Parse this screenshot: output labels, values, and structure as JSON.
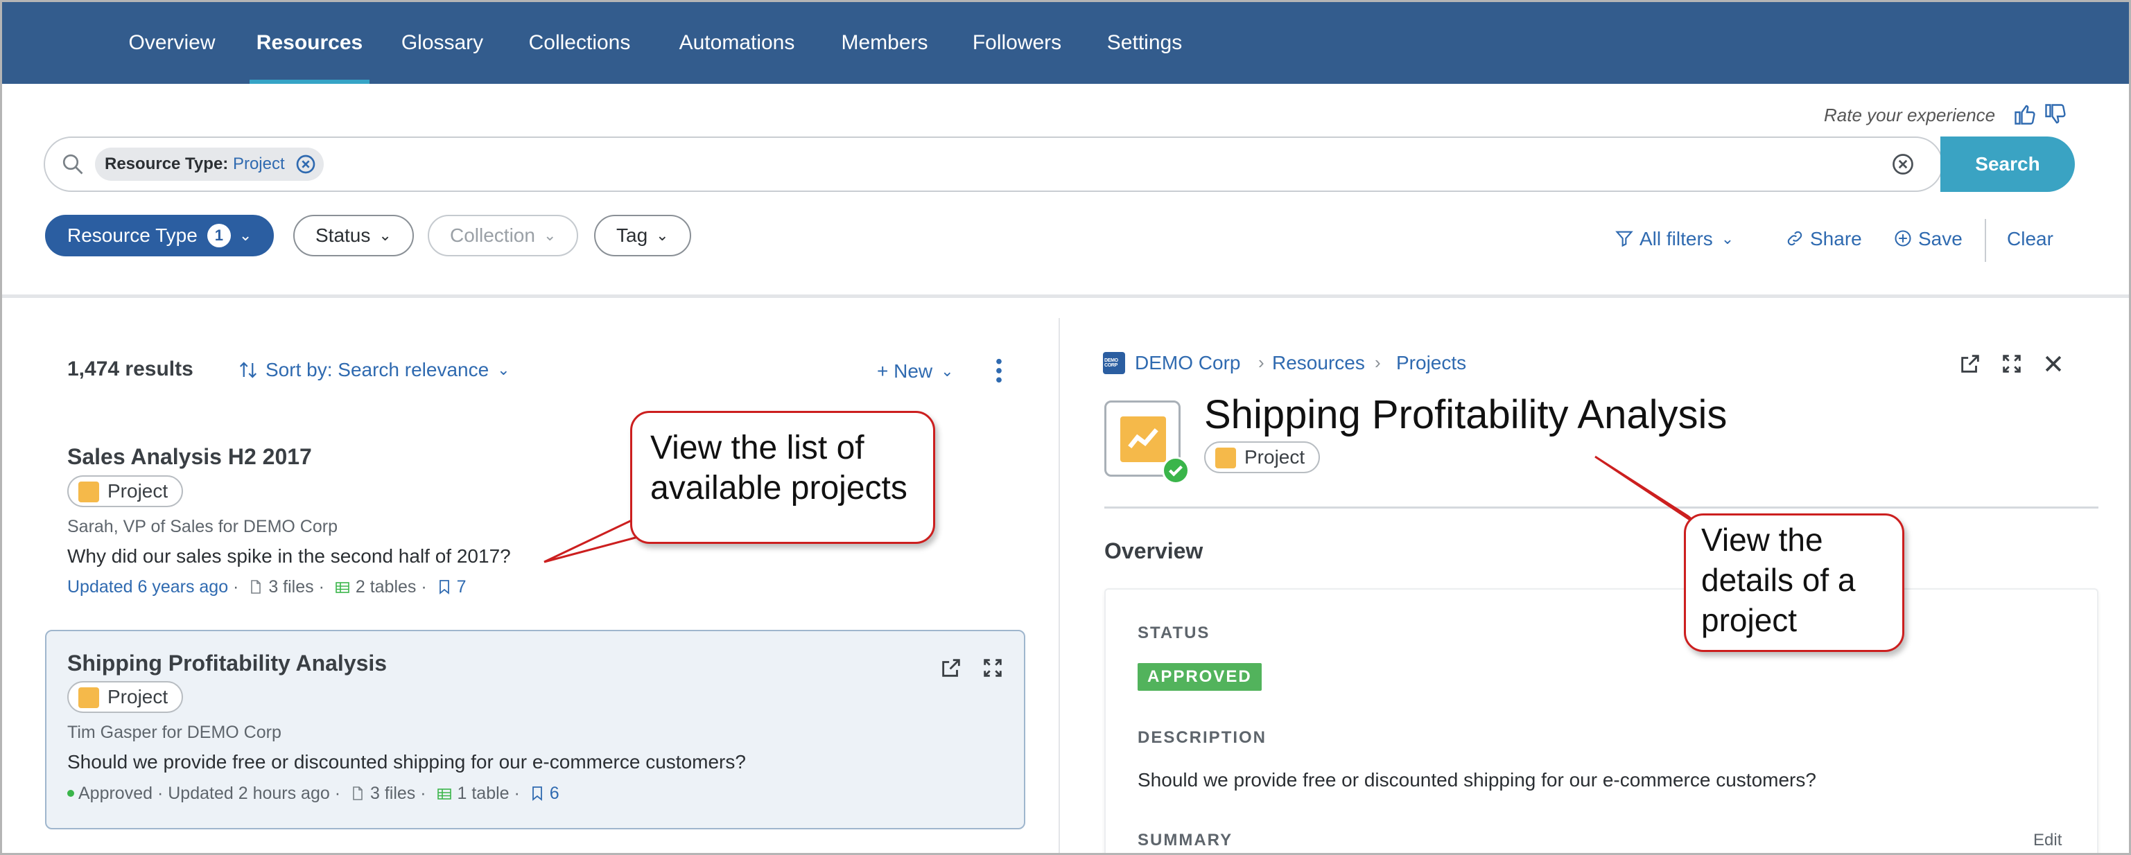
{
  "nav": {
    "tabs": [
      "Overview",
      "Resources",
      "Glossary",
      "Collections",
      "Automations",
      "Members",
      "Followers",
      "Settings"
    ],
    "active": "Resources"
  },
  "rate": {
    "label": "Rate your experience"
  },
  "search": {
    "chip_key": "Resource Type:",
    "chip_value": "Project",
    "button": "Search"
  },
  "filters": {
    "resource_type": "Resource Type",
    "resource_type_count": "1",
    "status": "Status",
    "collection": "Collection",
    "tag": "Tag",
    "all_filters": "All filters",
    "share": "Share",
    "save": "Save",
    "clear": "Clear"
  },
  "list": {
    "count": "1,474 results",
    "sort": "Sort by: Search relevance",
    "new": "+ New",
    "items": [
      {
        "title": "Sales Analysis H2 2017",
        "type": "Project",
        "author": "Sarah, VP of Sales for DEMO Corp",
        "question": "Why did our sales spike in the second half of 2017?",
        "updated": "Updated 6 years ago",
        "files": "3 files",
        "tables": "2 tables",
        "bookmarks": "7"
      },
      {
        "title": "Shipping Profitability Analysis",
        "type": "Project",
        "author": "Tim Gasper for DEMO Corp",
        "question": "Should we provide free or discounted shipping for our e-commerce customers?",
        "status": "Approved",
        "updated": "Updated 2 hours ago",
        "files": "3 files",
        "tables": "1 table",
        "bookmarks": "6"
      }
    ]
  },
  "callouts": {
    "list": "View the list of available projects",
    "details": "View the details of a project"
  },
  "detail": {
    "breadcrumb": [
      "DEMO Corp",
      "Resources",
      "Projects"
    ],
    "title": "Shipping Profitability Analysis",
    "type": "Project",
    "overview": "Overview",
    "status_label": "STATUS",
    "status_value": "APPROVED",
    "description_label": "DESCRIPTION",
    "description": "Should we provide free or discounted shipping for our e-commerce customers?",
    "summary_label": "SUMMARY",
    "edit": "Edit"
  },
  "colors": {
    "nav": "#335c8d",
    "accent": "#2f6ab0",
    "search_button": "#3aa3c3",
    "approved": "#52b35c",
    "callout_border": "#cc1f1f",
    "project_icon": "#f5b94a"
  },
  "icons": [
    "search-icon",
    "close-circle-icon",
    "thumbs-up-icon",
    "thumbs-down-icon",
    "filter-icon",
    "link-icon",
    "plus-circle-icon",
    "sort-icon",
    "kebab-icon",
    "file-icon",
    "table-icon",
    "bookmark-icon",
    "external-link-icon",
    "expand-icon",
    "close-icon",
    "project-icon",
    "check-icon"
  ]
}
